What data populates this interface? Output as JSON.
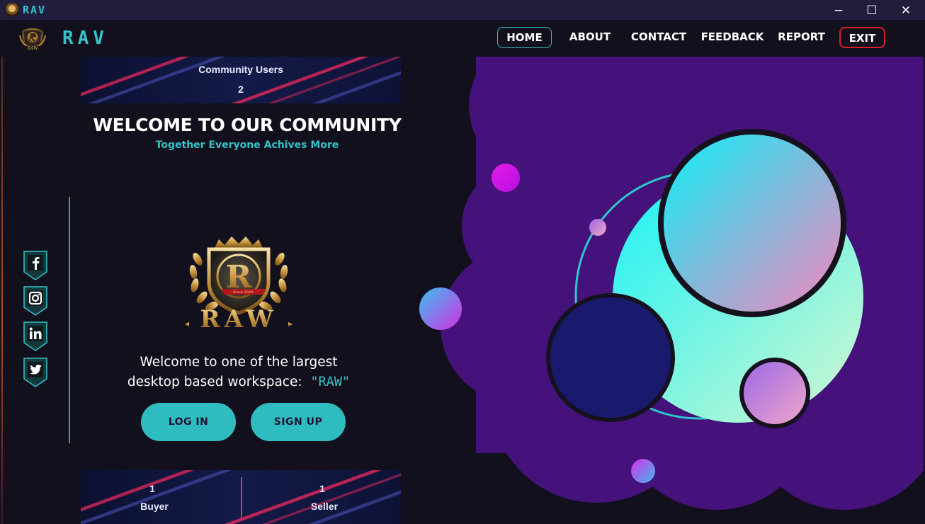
{
  "window": {
    "title": "RAV",
    "minimize": "−",
    "maximize": "☐",
    "close": "✕"
  },
  "header": {
    "brand": "RAV",
    "nav": [
      {
        "label": "HOME"
      },
      {
        "label": "ABOUT"
      },
      {
        "label": "CONTACT"
      },
      {
        "label": "FEEDBACK"
      },
      {
        "label": "REPORT"
      },
      {
        "label": "EXIT"
      }
    ]
  },
  "community": {
    "label": "Community Users",
    "count": "2"
  },
  "welcome": {
    "title": "WELCOME TO OUR COMMUNITY",
    "subtitle": "Together Everyone Achives More"
  },
  "logo": {
    "text": "RAW",
    "ribbon": "Since 2020"
  },
  "intro": {
    "line1": "Welcome to one of the largest",
    "line2": "desktop based workspace:",
    "highlight": "\"RAW\""
  },
  "buttons": {
    "login": "LOG IN",
    "signup": "SIGN UP"
  },
  "stats": {
    "buyer_count": "1",
    "buyer_label": "Buyer",
    "seller_count": "1",
    "seller_label": "Seller"
  },
  "social": [
    "facebook-icon",
    "instagram-icon",
    "linkedin-icon",
    "twitter-icon"
  ],
  "colors": {
    "accent": "#35c2c8",
    "exit": "#d61f2b",
    "background": "#12101c",
    "blob": "#44127a"
  }
}
